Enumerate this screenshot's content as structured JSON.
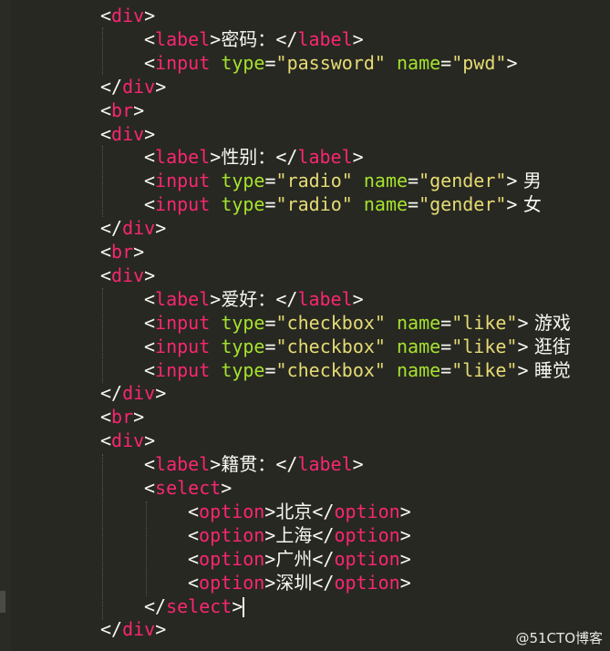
{
  "editor": {
    "lines": [
      [
        "<",
        "div",
        ">"
      ],
      [
        "<",
        "label",
        ">",
        "密码：",
        "</",
        "label",
        ">"
      ],
      [
        "<",
        "input",
        " ",
        "type",
        "=",
        "\"password\"",
        " ",
        "name",
        "=",
        "\"pwd\"",
        ">"
      ],
      [
        "</",
        "div",
        ">"
      ],
      [
        "<",
        "br",
        ">"
      ],
      [
        "<",
        "div",
        ">"
      ],
      [
        "<",
        "label",
        ">",
        "性别：",
        "</",
        "label",
        ">"
      ],
      [
        "<",
        "input",
        " ",
        "type",
        "=",
        "\"radio\"",
        " ",
        "name",
        "=",
        "\"gender\"",
        ">",
        " 男"
      ],
      [
        "<",
        "input",
        " ",
        "type",
        "=",
        "\"radio\"",
        " ",
        "name",
        "=",
        "\"gender\"",
        ">",
        " 女"
      ],
      [
        "</",
        "div",
        ">"
      ],
      [
        "<",
        "br",
        ">"
      ],
      [
        "<",
        "div",
        ">"
      ],
      [
        "<",
        "label",
        ">",
        "爱好：",
        "</",
        "label",
        ">"
      ],
      [
        "<",
        "input",
        " ",
        "type",
        "=",
        "\"checkbox\"",
        " ",
        "name",
        "=",
        "\"like\"",
        ">",
        " 游戏"
      ],
      [
        "<",
        "input",
        " ",
        "type",
        "=",
        "\"checkbox\"",
        " ",
        "name",
        "=",
        "\"like\"",
        ">",
        " 逛街"
      ],
      [
        "<",
        "input",
        " ",
        "type",
        "=",
        "\"checkbox\"",
        " ",
        "name",
        "=",
        "\"like\"",
        ">",
        " 睡觉"
      ],
      [
        "</",
        "div",
        ">"
      ],
      [
        "<",
        "br",
        ">"
      ],
      [
        "<",
        "div",
        ">"
      ],
      [
        "<",
        "label",
        ">",
        "籍贯：",
        "</",
        "label",
        ">"
      ],
      [
        "<",
        "select",
        ">"
      ],
      [
        "<",
        "option",
        ">",
        "北京",
        "</",
        "option",
        ">"
      ],
      [
        "<",
        "option",
        ">",
        "上海",
        "</",
        "option",
        ">"
      ],
      [
        "<",
        "option",
        ">",
        "广州",
        "</",
        "option",
        ">"
      ],
      [
        "<",
        "option",
        ">",
        "深圳",
        "</",
        "option",
        ">"
      ],
      [
        "</",
        "select",
        ">"
      ],
      [
        "</",
        "div",
        ">"
      ]
    ]
  },
  "watermark": "@51CTO博客",
  "colors": {
    "background": "#272822",
    "tag": "#f92672",
    "attribute": "#a6e22e",
    "string": "#e6db74",
    "text": "#f8f8f2"
  }
}
